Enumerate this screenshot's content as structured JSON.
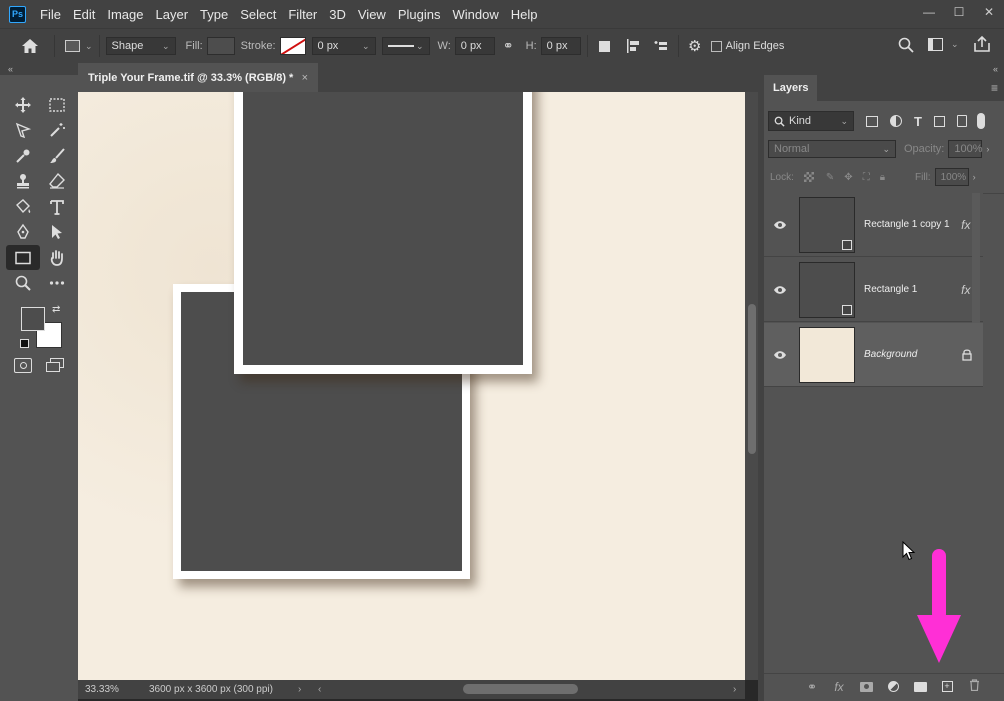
{
  "app": {
    "logo": "Ps"
  },
  "menu": [
    "File",
    "Edit",
    "Image",
    "Layer",
    "Type",
    "Select",
    "Filter",
    "3D",
    "View",
    "Plugins",
    "Window",
    "Help"
  ],
  "window_controls": {
    "minimize": "—",
    "maximize": "☐",
    "close": "✕"
  },
  "options": {
    "mode": "Shape",
    "fill_label": "Fill:",
    "stroke_label": "Stroke:",
    "stroke_width": "0 px",
    "w_label": "W:",
    "w_value": "0 px",
    "h_label": "H:",
    "h_value": "0 px",
    "align_edges": "Align Edges",
    "collapse": "«"
  },
  "document": {
    "tab_title": "Triple Your Frame.tif @ 33.3% (RGB/8) *",
    "tab_close": "×",
    "zoom": "33.33%",
    "info": "3600 px x 3600 px (300 ppi)"
  },
  "layers_panel": {
    "title": "Layers",
    "menu_icon": "≡",
    "collapse": "«",
    "filter_kind": "Kind",
    "blend_mode": "Normal",
    "opacity_label": "Opacity:",
    "opacity_value": "100%",
    "lock_label": "Lock:",
    "fill_label": "Fill:",
    "fill_value": "100%",
    "layers": [
      {
        "name": "Rectangle 1 copy 1",
        "fx": "fx"
      },
      {
        "name": "Rectangle 1",
        "fx": "fx"
      },
      {
        "name": "Background",
        "locked": true
      }
    ],
    "bottom_icons": [
      "link-icon",
      "fx-icon",
      "mask-icon",
      "adjustment-icon",
      "folder-icon",
      "new-layer-icon",
      "trash-icon"
    ]
  },
  "annotation": {
    "arrow_color": "#ff2fd6"
  }
}
